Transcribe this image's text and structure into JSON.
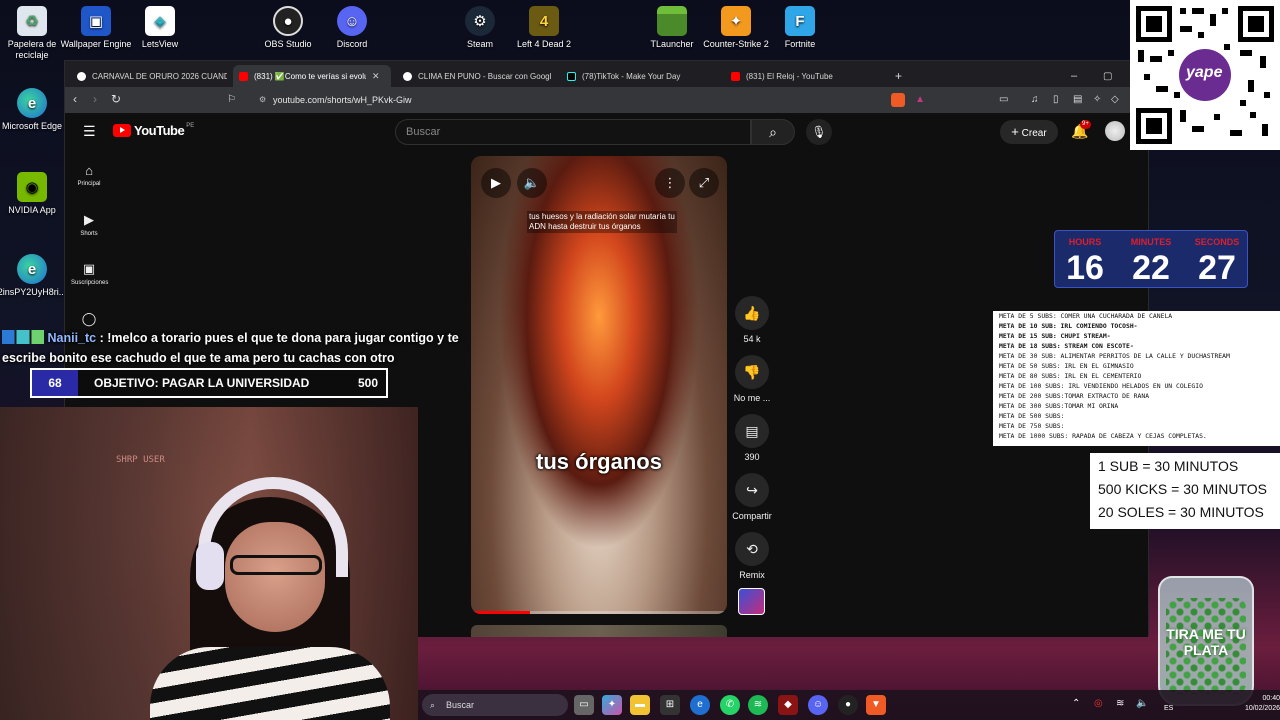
{
  "desktop_icons": [
    {
      "label": "Papelera de reciclaje",
      "icon": "recycle-bin-icon"
    },
    {
      "label": "Wallpaper Engine",
      "icon": "wallpaper-engine-icon"
    },
    {
      "label": "LetsView",
      "icon": "letsview-icon"
    },
    {
      "label": "OBS Studio",
      "icon": "obs-icon"
    },
    {
      "label": "Discord",
      "icon": "discord-icon"
    },
    {
      "label": "Steam",
      "icon": "steam-icon"
    },
    {
      "label": "Left 4 Dead 2",
      "icon": "left4dead2-icon"
    },
    {
      "label": "TLauncher",
      "icon": "tlauncher-icon"
    },
    {
      "label": "Counter-Strike 2",
      "icon": "cs2-icon"
    },
    {
      "label": "Fortnite",
      "icon": "fortnite-icon"
    },
    {
      "label": "Microsoft Edge",
      "icon": "edge-icon"
    },
    {
      "label": "NVIDIA App",
      "icon": "nvidia-icon"
    },
    {
      "label": "2insPY2UyH8ri...",
      "icon": "edge-shortcut-icon"
    }
  ],
  "browser": {
    "tabs": [
      {
        "title": "CARNAVAL DE ORURO 2026 CUANDO",
        "active": false
      },
      {
        "title": "(831) ✅Como te verías si evolu",
        "active": true
      },
      {
        "title": "CLIMA EN PUNO - Buscar con Googl",
        "active": false
      },
      {
        "title": "(78)TikTok - Make Your Day",
        "active": false
      },
      {
        "title": "(831) El Reloj - YouTube",
        "active": false
      }
    ],
    "url": "youtube.com/shorts/wH_PKvk-Giw"
  },
  "youtube": {
    "logo": "YouTube",
    "region": "PE",
    "search_placeholder": "Buscar",
    "create_label": "Crear",
    "notifications": "9+",
    "sidebar": [
      {
        "label": "Principal",
        "icon": "home-icon"
      },
      {
        "label": "Shorts",
        "icon": "shorts-icon"
      },
      {
        "label": "Suscripciones",
        "icon": "subscriptions-icon"
      }
    ],
    "video": {
      "caption_top": "tus huesos y la radiación solar mutaría tu ADN hasta destruir tus órganos",
      "caption_big": "tus órganos",
      "progress": 0.23
    },
    "actions": [
      {
        "label": "54 k",
        "icon": "like-icon"
      },
      {
        "label": "No me ...",
        "icon": "dislike-icon"
      },
      {
        "label": "390",
        "icon": "comment-icon"
      },
      {
        "label": "Compartir",
        "icon": "share-icon"
      },
      {
        "label": "Remix",
        "icon": "remix-icon"
      }
    ]
  },
  "stream": {
    "chat_user": "Nanii_tc",
    "chat_message": ": !melco a torario pues el que te dona para jugar contigo y te escribe bonito ese cachudo el que te ama pero tu cachas con otro",
    "goal": {
      "current": "68",
      "title": "OBJETIVO: PAGAR LA UNIVERSIDAD",
      "target": "500"
    },
    "webcam_sign": "SHRP USER",
    "timer": {
      "hours_label": "HOURS",
      "minutes_label": "MINUTES",
      "seconds_label": "SECONDS",
      "hours": "16",
      "minutes": "22",
      "seconds": "27"
    },
    "metas": [
      {
        "text": "META DE 5 SUBS: COMER UNA CUCHARADA DE CANELA",
        "bold": false
      },
      {
        "text": "META DE 10 SUB: IRL COMIENDO TOCOSH-",
        "bold": true
      },
      {
        "text": "META DE 15 SUB: CHUPI STREAM-",
        "bold": true
      },
      {
        "text": "META DE 18 SUBS: STREAM CON ESCOTE-",
        "bold": true
      },
      {
        "text": "META DE 30 SUB:  ALIMENTAR PERRITOS DE LA CALLE Y DUCHASTREAM",
        "bold": false
      },
      {
        "text": "META DE 50 SUBS: IRL EN EL GIMNASIO",
        "bold": false
      },
      {
        "text": "META DE 80 SUBS: IRL EN EL CEMENTERIO",
        "bold": false
      },
      {
        "text": "META DE 100 SUBS: IRL VENDIENDO HELADOS EN UN COLEGIO",
        "bold": false
      },
      {
        "text": "META DE 200 SUBS:TOMAR EXTRACTO DE RANA",
        "bold": false
      },
      {
        "text": "META DE 300 SUBS:TOMAR MI ORINA",
        "bold": false
      },
      {
        "text": "META DE 500 SUBS:",
        "bold": false
      },
      {
        "text": "META DE 750 SUBS:",
        "bold": false
      },
      {
        "text": "META DE 1000 SUBS: RAPADA DE CABEZA Y CEJAS COMPLETAS.",
        "bold": false
      }
    ],
    "rates": [
      "1 SUB = 30 MINUTOS",
      "500 KICKS = 30 MINUTOS",
      "20 SOLES = 30 MINUTOS"
    ],
    "qr_brand": "yape",
    "jar_text": "TIRA ME TU PLATA"
  },
  "taskbar": {
    "search_placeholder": "Buscar",
    "lang": "ES",
    "time": "00:40",
    "date": "10/02/2026"
  }
}
